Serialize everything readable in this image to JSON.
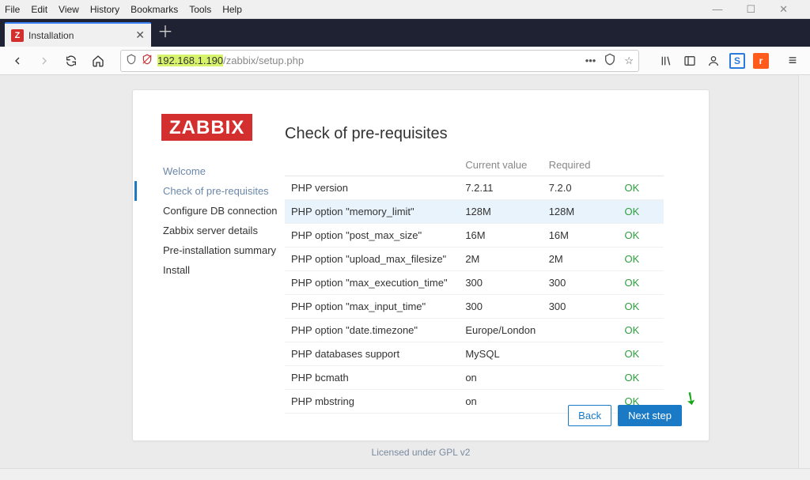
{
  "menubar": [
    "File",
    "Edit",
    "View",
    "History",
    "Bookmarks",
    "Tools",
    "Help"
  ],
  "tab": {
    "favicon_letter": "Z",
    "title": "Installation"
  },
  "url": {
    "highlight": "192.168.1.190",
    "path": "/zabbix/setup.php"
  },
  "logo": "ZABBIX",
  "heading": "Check of pre-requisites",
  "steps": [
    {
      "label": "Welcome",
      "state": "done"
    },
    {
      "label": "Check of pre-requisites",
      "state": "active"
    },
    {
      "label": "Configure DB connection",
      "state": ""
    },
    {
      "label": "Zabbix server details",
      "state": ""
    },
    {
      "label": "Pre-installation summary",
      "state": ""
    },
    {
      "label": "Install",
      "state": ""
    }
  ],
  "table": {
    "headers": {
      "name": "",
      "current": "Current value",
      "required": "Required",
      "status": ""
    },
    "rows": [
      {
        "name": "PHP version",
        "current": "7.2.11",
        "required": "7.2.0",
        "status": "OK"
      },
      {
        "name": "PHP option \"memory_limit\"",
        "current": "128M",
        "required": "128M",
        "status": "OK",
        "hl": true
      },
      {
        "name": "PHP option \"post_max_size\"",
        "current": "16M",
        "required": "16M",
        "status": "OK"
      },
      {
        "name": "PHP option \"upload_max_filesize\"",
        "current": "2M",
        "required": "2M",
        "status": "OK"
      },
      {
        "name": "PHP option \"max_execution_time\"",
        "current": "300",
        "required": "300",
        "status": "OK"
      },
      {
        "name": "PHP option \"max_input_time\"",
        "current": "300",
        "required": "300",
        "status": "OK"
      },
      {
        "name": "PHP option \"date.timezone\"",
        "current": "Europe/London",
        "required": "",
        "status": "OK"
      },
      {
        "name": "PHP databases support",
        "current": "MySQL",
        "required": "",
        "status": "OK"
      },
      {
        "name": "PHP bcmath",
        "current": "on",
        "required": "",
        "status": "OK"
      },
      {
        "name": "PHP mbstring",
        "current": "on",
        "required": "",
        "status": "OK"
      }
    ]
  },
  "buttons": {
    "back": "Back",
    "next": "Next step"
  },
  "license": "Licensed under GPL v2"
}
